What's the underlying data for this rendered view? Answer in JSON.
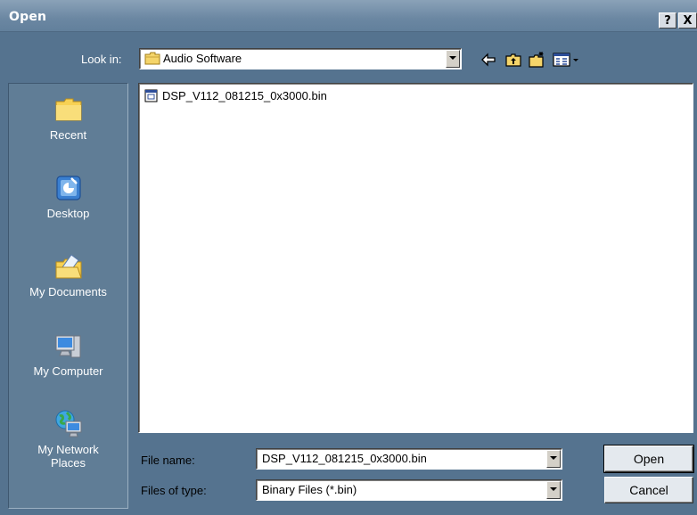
{
  "window": {
    "title": "Open",
    "help_label": "?",
    "close_label": "X"
  },
  "toolbar": {
    "look_in_label": "Look in:",
    "look_in_value": "Audio Software",
    "icons": [
      "back-arrow-icon",
      "up-folder-icon",
      "new-folder-icon",
      "view-menu-icon"
    ]
  },
  "places": [
    {
      "label": "Recent",
      "icon": "recent-folder-icon"
    },
    {
      "label": "Desktop",
      "icon": "desktop-icon"
    },
    {
      "label": "My Documents",
      "icon": "my-documents-icon"
    },
    {
      "label": "My Computer",
      "icon": "my-computer-icon"
    },
    {
      "label": "My Network\nPlaces",
      "icon": "network-places-icon"
    }
  ],
  "files": [
    {
      "name": "DSP_V112_081215_0x3000.bin",
      "icon": "binary-file-icon"
    }
  ],
  "form": {
    "file_name_label": "File name:",
    "file_name_value": "DSP_V112_081215_0x3000.bin",
    "file_type_label": "Files of type:",
    "file_type_value": "Binary Files (*.bin)"
  },
  "buttons": {
    "open": "Open",
    "cancel": "Cancel"
  }
}
